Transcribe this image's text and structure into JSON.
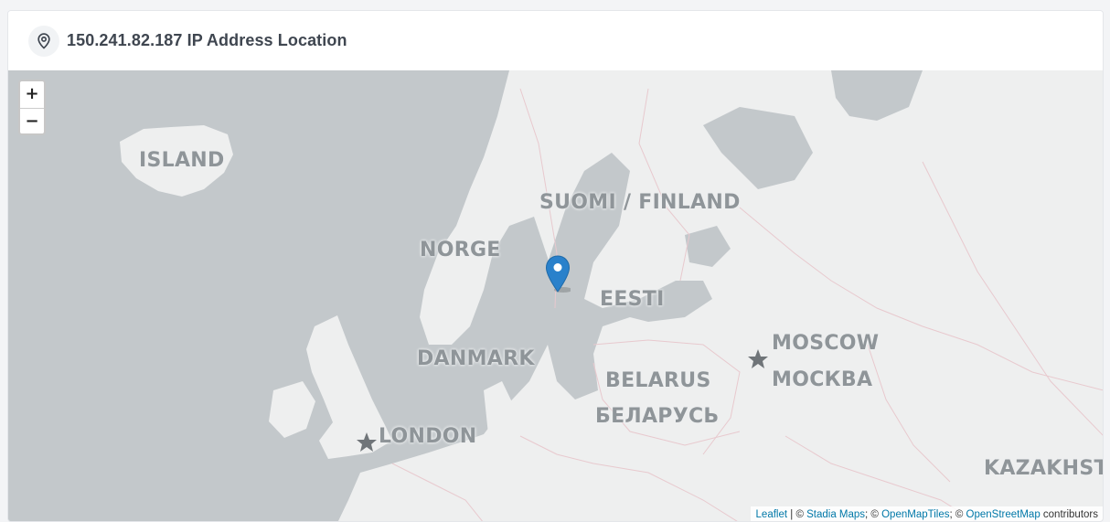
{
  "header": {
    "title": "150.241.82.187 IP Address Location",
    "icon": "location-pin-icon"
  },
  "map": {
    "zoom_in_label": "+",
    "zoom_out_label": "−",
    "labels": {
      "iceland": "ISLAND",
      "finland": "SUOMI / FINLAND",
      "norway": "NORGE",
      "estonia": "EESTI",
      "denmark": "DANMARK",
      "belarus": "BELARUS",
      "belarus_cyr": "БЕЛАРУСЬ",
      "moscow": "MOSCOW",
      "moscow_cyr": "МОСКВА",
      "london": "LONDON",
      "kazakhstan": "KAZAKHST"
    },
    "marker": {
      "icon": "map-marker-icon",
      "color": "#2a81cb"
    },
    "colors": {
      "water": "#c3c8cb",
      "land": "#eeefef",
      "border": "#e8c9ce"
    }
  },
  "attribution": {
    "leaflet": "Leaflet",
    "sep1": " | © ",
    "stadia": "Stadia Maps",
    "sep2": "; © ",
    "openmaptiles": "OpenMapTiles",
    "sep3": "; © ",
    "osm": "OpenStreetMap",
    "suffix": " contributors"
  }
}
